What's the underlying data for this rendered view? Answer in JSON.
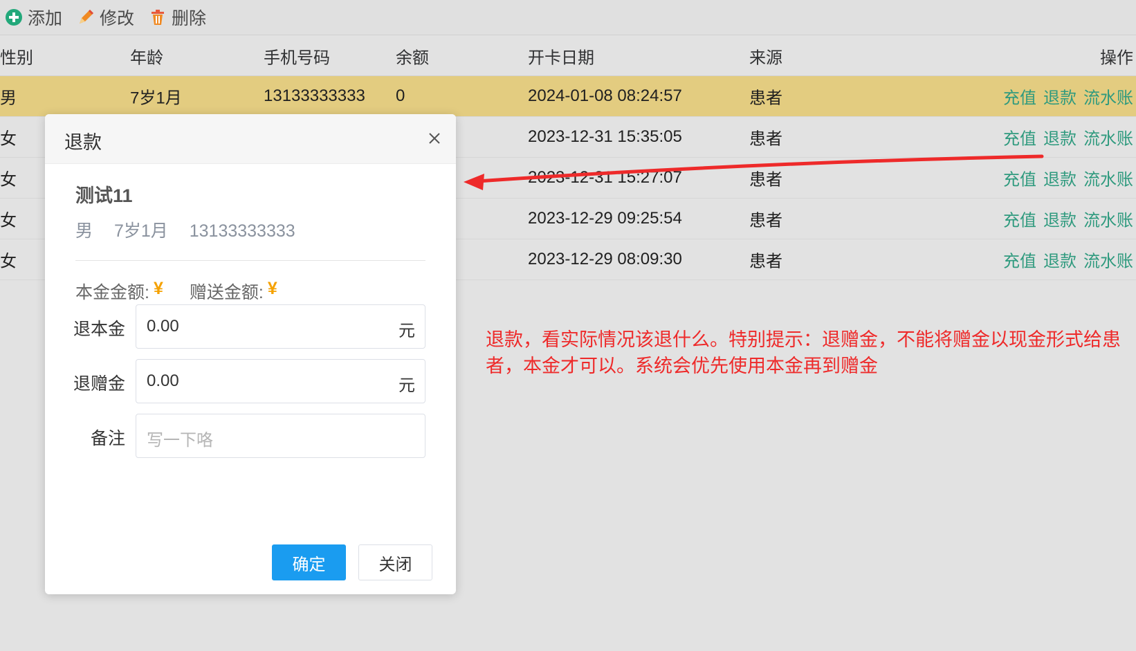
{
  "toolbar": {
    "add_label": "添加",
    "edit_label": "修改",
    "delete_label": "删除"
  },
  "table": {
    "headers": {
      "gender": "性别",
      "age": "年龄",
      "phone": "手机号码",
      "balance": "余额",
      "open_date": "开卡日期",
      "source": "来源",
      "ops": "操作"
    },
    "op_labels": {
      "recharge": "充值",
      "refund": "退款",
      "ledger": "流水账"
    },
    "rows": [
      {
        "gender": "男",
        "age": "7岁1月",
        "phone": "13133333333",
        "balance": "0",
        "open_date": "2024-01-08 08:24:57",
        "source": "患者"
      },
      {
        "gender": "女",
        "open_date": "2023-12-31 15:35:05",
        "source": "患者"
      },
      {
        "gender": "女",
        "open_date": "2023-12-31 15:27:07",
        "source": "患者"
      },
      {
        "gender": "女",
        "open_date": "2023-12-29 09:25:54",
        "source": "患者"
      },
      {
        "gender": "女",
        "open_date": "2023-12-29 08:09:30",
        "source": "患者"
      }
    ]
  },
  "annotation": {
    "text": "退款，看实际情况该退什么。特别提示：退赠金，不能将赠金以现金形式给患者，本金才可以。系统会优先使用本金再到赠金",
    "color": "#ee2a2a"
  },
  "modal": {
    "title": "退款",
    "patient": {
      "name": "测试11",
      "gender": "男",
      "age": "7岁1月",
      "phone": "13133333333"
    },
    "principal_label": "本金金额:",
    "principal_symbol": "¥",
    "gift_label": "赠送金额:",
    "gift_symbol": "¥",
    "refund_principal": {
      "label": "退本金",
      "value": "0.00",
      "unit": "元"
    },
    "refund_gift": {
      "label": "退赠金",
      "value": "0.00",
      "unit": "元"
    },
    "remark": {
      "label": "备注",
      "placeholder": "写一下咯"
    },
    "confirm_label": "确定",
    "close_label": "关闭"
  },
  "colors": {
    "selected_row": "#e3cc80",
    "link": "#2f9a7e",
    "primary": "#1a9cf0",
    "currency": "#f5a100"
  }
}
